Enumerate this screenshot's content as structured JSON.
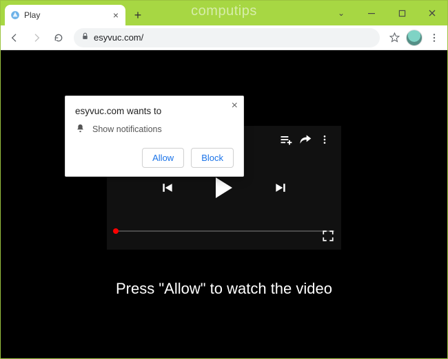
{
  "window": {
    "watermark": "computips"
  },
  "tab": {
    "title": "Play"
  },
  "url": "esyvuc.com/",
  "permission": {
    "title": "esyvuc.com wants to",
    "body": "Show notifications",
    "allow": "Allow",
    "block": "Block"
  },
  "page": {
    "caption": "Press \"Allow\" to watch the video"
  }
}
